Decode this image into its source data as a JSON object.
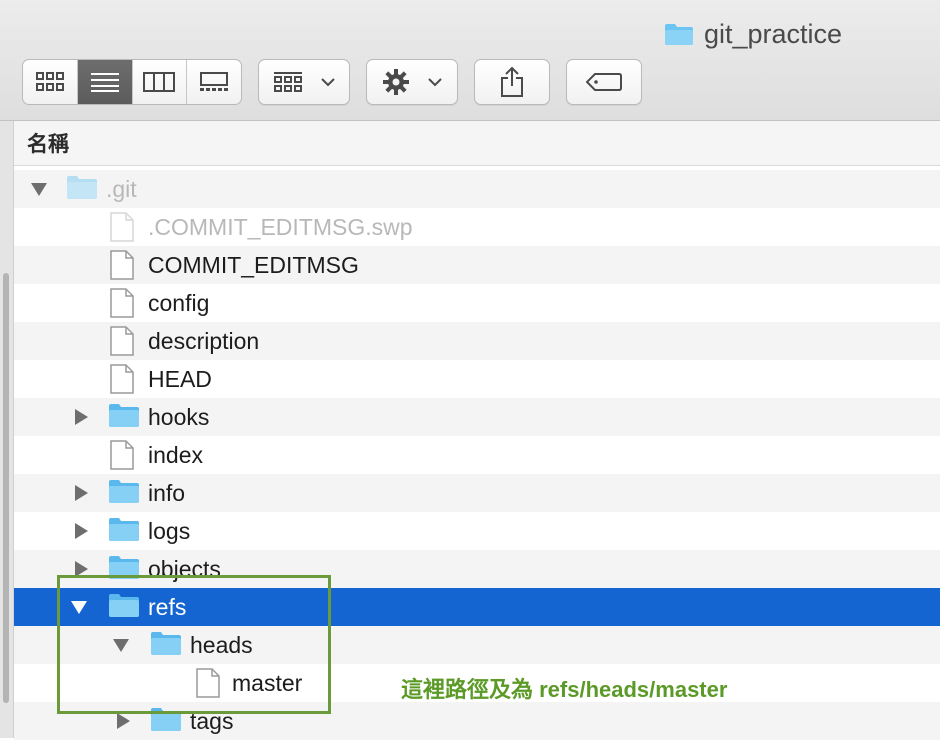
{
  "window": {
    "title": "git_practice"
  },
  "toolbar": {
    "view_modes": [
      "icon-view",
      "list-view",
      "column-view",
      "gallery-view"
    ],
    "active_view": "list-view"
  },
  "list": {
    "header": "名稱",
    "rows": [
      {
        "name": ".git",
        "kind": "folder",
        "expanded": true,
        "dimmed": true
      },
      {
        "name": ".COMMIT_EDITMSG.swp",
        "kind": "file",
        "dimmed": true
      },
      {
        "name": "COMMIT_EDITMSG",
        "kind": "file"
      },
      {
        "name": "config",
        "kind": "file"
      },
      {
        "name": "description",
        "kind": "file"
      },
      {
        "name": "HEAD",
        "kind": "file"
      },
      {
        "name": "hooks",
        "kind": "folder",
        "expanded": false
      },
      {
        "name": "index",
        "kind": "file"
      },
      {
        "name": "info",
        "kind": "folder",
        "expanded": false
      },
      {
        "name": "logs",
        "kind": "folder",
        "expanded": false
      },
      {
        "name": "objects",
        "kind": "folder",
        "expanded": false
      },
      {
        "name": "refs",
        "kind": "folder",
        "expanded": true,
        "selected": true
      },
      {
        "name": "heads",
        "kind": "folder",
        "expanded": true
      },
      {
        "name": "master",
        "kind": "file"
      },
      {
        "name": "tags",
        "kind": "folder",
        "expanded": false
      }
    ]
  },
  "annotation": {
    "text": "這裡路徑及為 refs/heads/master"
  },
  "colors": {
    "selection": "#1464d2",
    "folder": "#6cc4f2",
    "annotation": "#5c9a28"
  }
}
